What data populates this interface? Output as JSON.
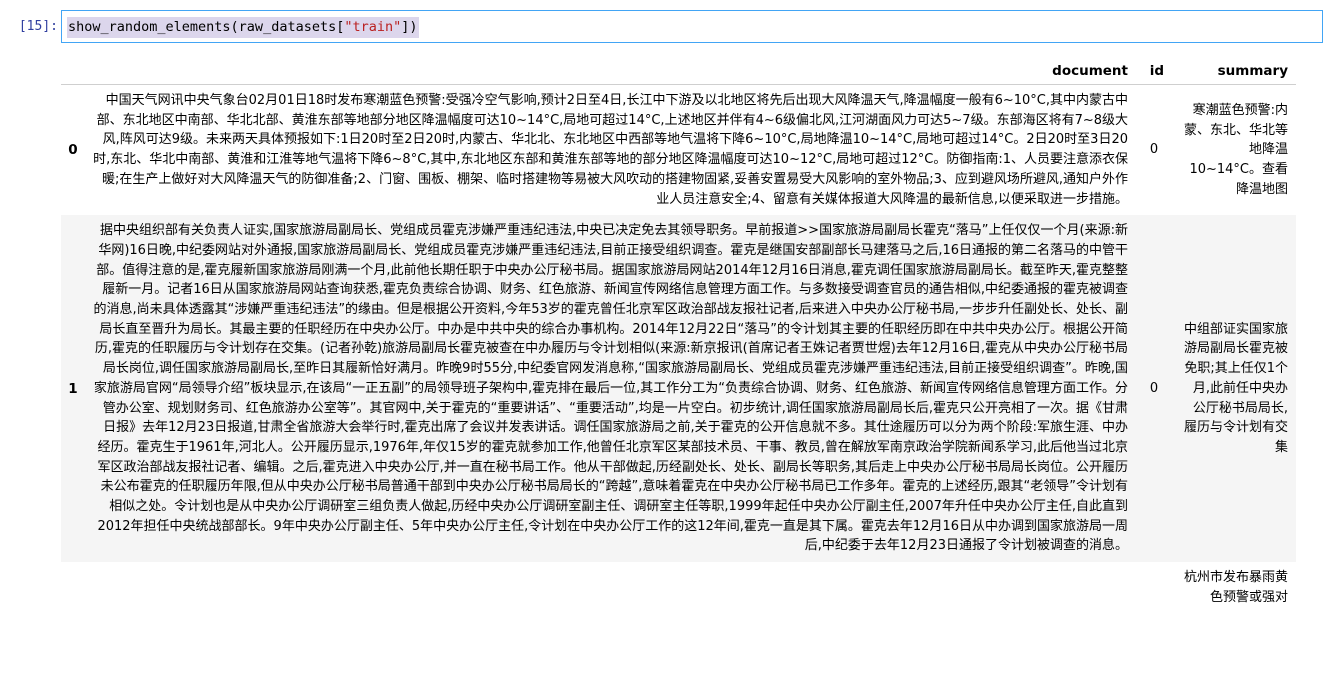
{
  "prompt": "[15]:",
  "code": {
    "func": "show_random_elements(raw_datasets[",
    "str": "\"train\"",
    "end": "])"
  },
  "table": {
    "headers": [
      "",
      "document",
      "id",
      "summary"
    ],
    "rows": [
      {
        "index": "0",
        "document": "中国天气网讯中央气象台02月01日18时发布寒潮蓝色预警:受强冷空气影响,预计2日至4日,长江中下游及以北地区将先后出现大风降温天气,降温幅度一般有6~10°C,其中内蒙古中部、东北地区中南部、华北北部、黄淮东部等地部分地区降温幅度可达10~14°C,局地可超过14°C,上述地区并伴有4~6级偏北风,江河湖面风力可达5~7级。东部海区将有7~8级大风,阵风可达9级。未来两天具体预报如下:1日20时至2日20时,内蒙古、华北北、东北地区中西部等地气温将下降6~10°C,局地降温10~14°C,局地可超过14°C。2日20时至3日20时,东北、华北中南部、黄淮和江淮等地气温将下降6~8°C,其中,东北地区东部和黄淮东部等地的部分地区降温幅度可达10~12°C,局地可超过12°C。防御指南:1、人员要注意添衣保暖;在生产上做好对大风降温天气的防御准备;2、门窗、围板、棚架、临时搭建物等易被大风吹动的搭建物固紧,妥善安置易受大风影响的室外物品;3、应到避风场所避风,通知户外作业人员注意安全;4、留意有关媒体报道大风降温的最新信息,以便采取进一步措施。",
        "id": "0",
        "summary": "寒潮蓝色预警:内蒙、东北、华北等地降温10~14°C。查看降温地图"
      },
      {
        "index": "1",
        "document": "据中央组织部有关负责人证实,国家旅游局副局长、党组成员霍克涉嫌严重违纪违法,中央已决定免去其领导职务。早前报道>>国家旅游局副局长霍克“落马”上任仅仅一个月(来源:新华网)16日晚,中纪委网站对外通报,国家旅游局副局长、党组成员霍克涉嫌严重违纪违法,目前正接受组织调查。霍克是继国安部副部长马建落马之后,16日通报的第二名落马的中管干部。值得注意的是,霍克履新国家旅游局刚满一个月,此前他长期任职于中央办公厅秘书局。据国家旅游局网站2014年12月16日消息,霍克调任国家旅游局副局长。截至昨天,霍克整整履新一月。记者16日从国家旅游局网站查询获悉,霍克负责综合协调、财务、红色旅游、新闻宣传网络信息管理方面工作。与多数接受调查官员的通告相似,中纪委通报的霍克被调查的消息,尚未具体透露其“涉嫌严重违纪违法”的缘由。但是根据公开资料,今年53岁的霍克曾任北京军区政治部战友报社记者,后来进入中央办公厅秘书局,一步步升任副处长、处长、副局长直至晋升为局长。其最主要的任职经历在中央办公厅。中办是中共中央的综合办事机构。2014年12月22日“落马”的令计划其主要的任职经历即在中共中央办公厅。根据公开简历,霍克的任职履历与令计划存在交集。(记者孙乾)旅游局副局长霍克被查在中办履历与令计划相似(来源:新京报讯(首席记者王姝记者贾世煜)去年12月16日,霍克从中央办公厅秘书局局长岗位,调任国家旅游局副局长,至昨日其履新恰好满月。昨晚9时55分,中纪委官网发消息称,“国家旅游局副局长、党组成员霍克涉嫌严重违纪违法,目前正接受组织调查”。昨晚,国家旅游局官网“局领导介绍”板块显示,在该局“一正五副”的局领导班子架构中,霍克排在最后一位,其工作分工为“负责综合协调、财务、红色旅游、新闻宣传网络信息管理方面工作。分管办公室、规划财务司、红色旅游办公室等”。其官网中,关于霍克的“重要讲话”、“重要活动”,均是一片空白。初步统计,调任国家旅游局副局长后,霍克只公开亮相了一次。据《甘肃日报》去年12月23日报道,甘肃全省旅游大会举行时,霍克出席了会议并发表讲话。调任国家旅游局之前,关于霍克的公开信息就不多。其仕途履历可以分为两个阶段:军旅生涯、中办经历。霍克生于1961年,河北人。公开履历显示,1976年,年仅15岁的霍克就参加工作,他曾任北京军区某部技术员、干事、教员,曾在解放军南京政治学院新闻系学习,此后他当过北京军区政治部战友报社记者、编辑。之后,霍克进入中央办公厅,并一直在秘书局工作。他从干部做起,历经副处长、处长、副局长等职务,其后走上中央办公厅秘书局局长岗位。公开履历未公布霍克的任职履历年限,但从中央办公厅秘书局普通干部到中央办公厅秘书局局长的“跨越”,意味着霍克在中央办公厅秘书局已工作多年。霍克的上述经历,跟其“老领导”令计划有相似之处。令计划也是从中央办公厅调研室三组负责人做起,历经中央办公厅调研室副主任、调研室主任等职,1999年起任中央办公厅副主任,2007年升任中央办公厅主任,自此直到2012年担任中央统战部部长。9年中央办公厅副主任、5年中央办公厅主任,令计划在中央办公厅工作的这12年间,霍克一直是其下属。霍克去年12月16日从中办调到国家旅游局一周后,中纪委于去年12月23日通报了令计划被调查的消息。",
        "id": "0",
        "summary": "中组部证实国家旅游局副局长霍克被免职;其上任仅1个月,此前任中央办公厅秘书局局长,履历与令计划有交集"
      },
      {
        "index": "",
        "document": "",
        "id": "",
        "summary": "杭州市发布暴雨黄色预警或强对"
      }
    ]
  }
}
